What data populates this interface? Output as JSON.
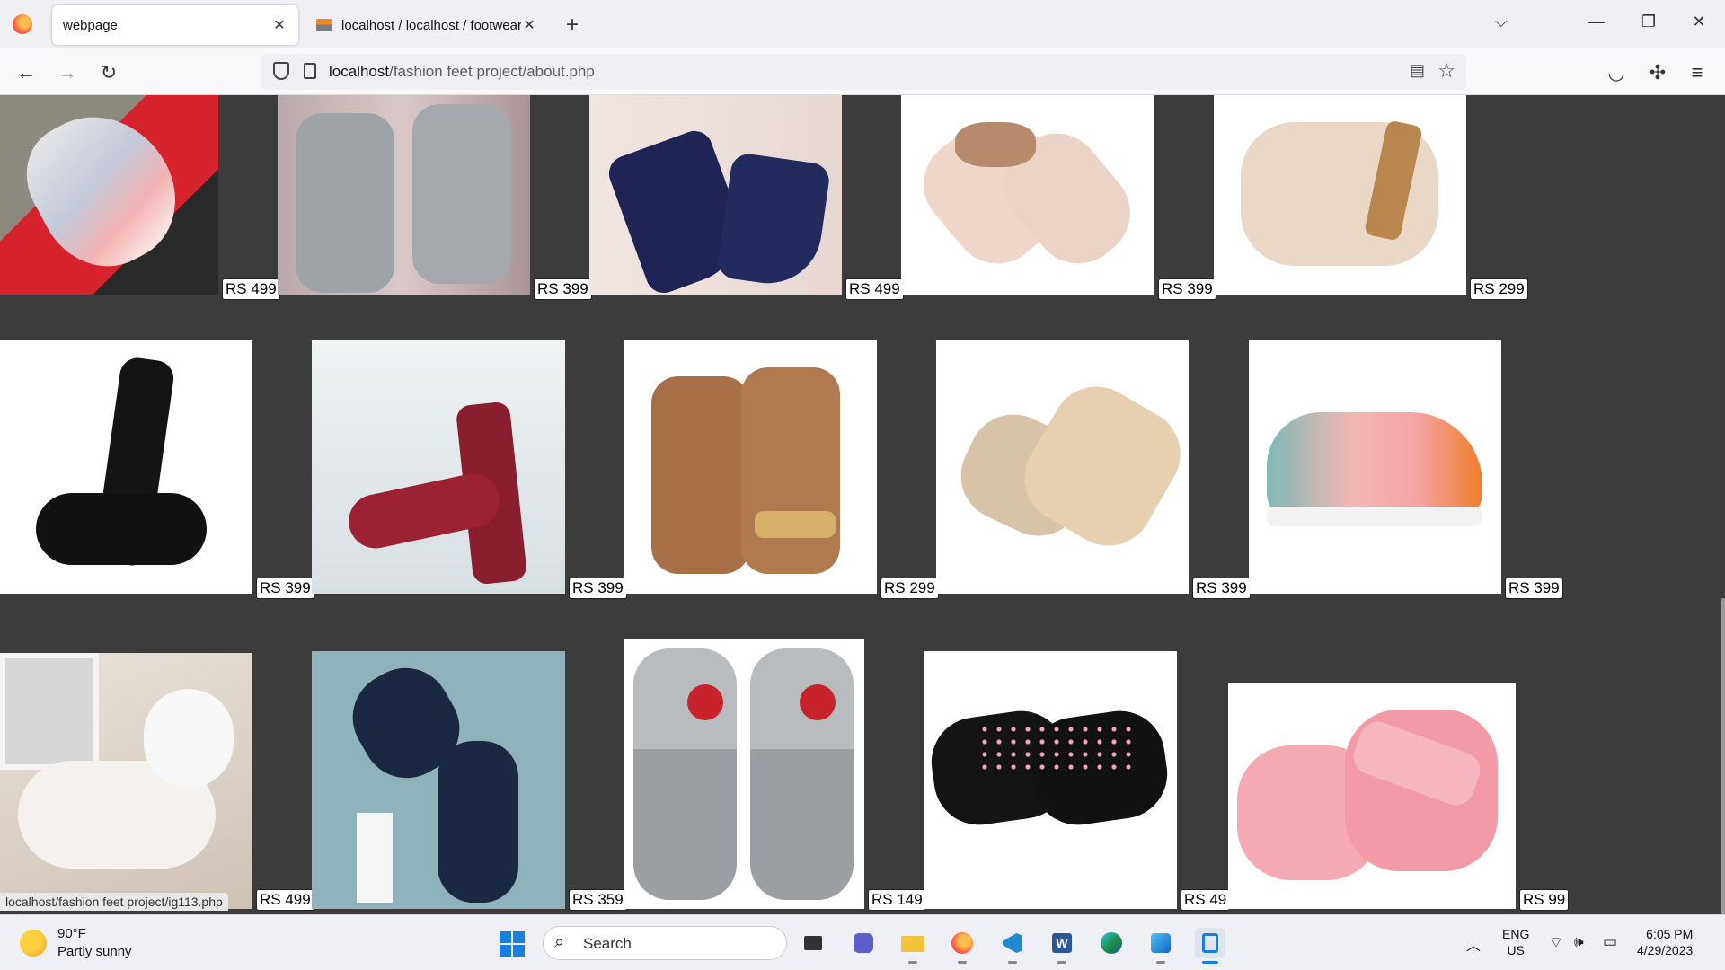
{
  "browser": {
    "tabs": [
      {
        "title": "webpage",
        "active": true
      },
      {
        "title": "localhost / localhost / footwear",
        "active": false
      }
    ],
    "url": {
      "host": "localhost",
      "path": "/fashion feet project/about.php"
    }
  },
  "products": [
    {
      "price": "RS 499",
      "item": "sneaker"
    },
    {
      "price": "RS 399",
      "item": "grey block heel sandal"
    },
    {
      "price": "RS 499",
      "item": "navy ankle strap flat"
    },
    {
      "price": "RS 399",
      "item": "bow flip flop"
    },
    {
      "price": "RS 299",
      "item": "beige strap sandal"
    },
    {
      "price": "RS 399",
      "item": "black platform heel"
    },
    {
      "price": "RS 399",
      "item": "red block heel"
    },
    {
      "price": "RS 299",
      "item": "tan ankle strap heel"
    },
    {
      "price": "RS 399",
      "item": "gold block heel"
    },
    {
      "price": "RS 399",
      "item": "pink sneaker"
    },
    {
      "price": "RS 499",
      "item": "white knit sneaker"
    },
    {
      "price": "RS 359",
      "item": "navy sneaker"
    },
    {
      "price": "RS 149",
      "item": "denim rose slide"
    },
    {
      "price": "RS 49",
      "item": "black heart slide"
    },
    {
      "price": "RS 99",
      "item": "pink panther slide"
    }
  ],
  "status_bar_link": "localhost/fashion feet project/ig113.php",
  "taskbar": {
    "weather_temp": "90°F",
    "weather_desc": "Partly sunny",
    "search_placeholder": "Search",
    "lang_top": "ENG",
    "lang_bottom": "US",
    "time": "6:05 PM",
    "date": "4/29/2023"
  }
}
